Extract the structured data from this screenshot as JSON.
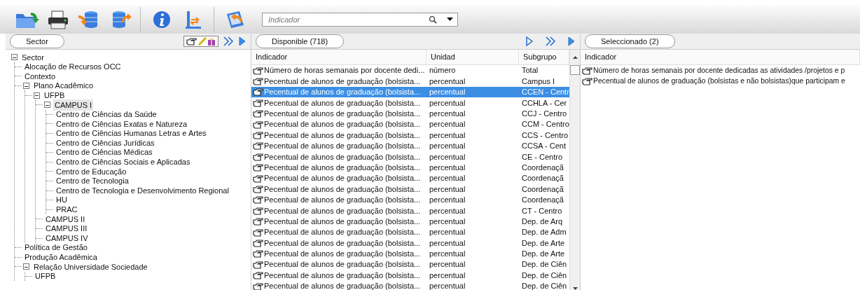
{
  "toolbar": {
    "search": {
      "placeholder": "Indicador"
    }
  },
  "sector_panel": {
    "title": "Sector",
    "tree": [
      {
        "label": "Sector",
        "expanded": true,
        "selected": false,
        "children": [
          {
            "label": "Alocação de Recursos OCC",
            "selected": false
          },
          {
            "label": "Contexto",
            "selected": false
          },
          {
            "label": "Plano Acadêmico",
            "expanded": true,
            "selected": false,
            "children": [
              {
                "label": "UFPB",
                "expanded": true,
                "selected": false,
                "children": [
                  {
                    "label": "CAMPUS I",
                    "expanded": true,
                    "selected": true,
                    "children": [
                      {
                        "label": "Centro de Ciências da Saúde",
                        "selected": false
                      },
                      {
                        "label": "Centro de Ciências Exatas e Natureza",
                        "selected": false
                      },
                      {
                        "label": "Centro de Ciências Humanas Letras e Artes",
                        "selected": false
                      },
                      {
                        "label": "Centro de Ciências Jurídicas",
                        "selected": false
                      },
                      {
                        "label": "Centro de Ciências Médicas",
                        "selected": false
                      },
                      {
                        "label": "Centro de Ciências Sociais e Aplicadas",
                        "selected": false
                      },
                      {
                        "label": "Centro de Educação",
                        "selected": false
                      },
                      {
                        "label": "Centro de Tecnologia",
                        "selected": false
                      },
                      {
                        "label": "Centro de Tecnologia e Desenvolvimento Regional",
                        "selected": false
                      },
                      {
                        "label": "HU",
                        "selected": false
                      },
                      {
                        "label": "PRAC",
                        "selected": false
                      }
                    ]
                  },
                  {
                    "label": "CAMPUS II",
                    "selected": false
                  },
                  {
                    "label": "CAMPUS III",
                    "selected": false
                  },
                  {
                    "label": "CAMPUS IV",
                    "selected": false
                  }
                ]
              }
            ]
          },
          {
            "label": "Política de Gestão",
            "selected": false
          },
          {
            "label": "Produção Acadêmica",
            "selected": false
          },
          {
            "label": "Relação Universidade Sociedade",
            "expanded": true,
            "selected": false,
            "children": [
              {
                "label": "UFPB",
                "selected": false
              }
            ]
          }
        ]
      }
    ]
  },
  "available_panel": {
    "title": "Disponible (718)",
    "table": {
      "columns": [
        "Indicador",
        "Unidad",
        "Subgrupo"
      ],
      "rows": [
        {
          "indicador": "Número de horas semanais por docente dedi...",
          "unidad": "número",
          "subgrupo": "Total",
          "selected": false
        },
        {
          "indicador": "Pecentual de alunos de graduação (bolsista...",
          "unidad": "percentual",
          "subgrupo": "Campus I",
          "selected": false
        },
        {
          "indicador": "Pecentual de alunos de graduação (bolsista...",
          "unidad": "percentual",
          "subgrupo": "CCEN - Centr",
          "selected": true
        },
        {
          "indicador": "Pecentual de alunos de graduação (bolsista...",
          "unidad": "percentual",
          "subgrupo": "CCHLA - Cer",
          "selected": false
        },
        {
          "indicador": "Pecentual de alunos de graduação (bolsista...",
          "unidad": "percentual",
          "subgrupo": "CCJ - Centro",
          "selected": false
        },
        {
          "indicador": "Pecentual de alunos de graduação (bolsista...",
          "unidad": "percentual",
          "subgrupo": "CCM - Centro",
          "selected": false
        },
        {
          "indicador": "Pecentual de alunos de graduação (bolsista...",
          "unidad": "percentual",
          "subgrupo": "CCS - Centro",
          "selected": false
        },
        {
          "indicador": "Pecentual de alunos de graduação (bolsista...",
          "unidad": "percentual",
          "subgrupo": "CCSA - Cent",
          "selected": false
        },
        {
          "indicador": "Pecentual de alunos de graduação (bolsista...",
          "unidad": "percentual",
          "subgrupo": "CE - Centro",
          "selected": false
        },
        {
          "indicador": "Pecentual de alunos de graduação (bolsista...",
          "unidad": "percentual",
          "subgrupo": "Coordenaçã",
          "selected": false
        },
        {
          "indicador": "Pecentual de alunos de graduação (bolsista...",
          "unidad": "percentual",
          "subgrupo": "Coordenaçã",
          "selected": false
        },
        {
          "indicador": "Pecentual de alunos de graduação (bolsista...",
          "unidad": "percentual",
          "subgrupo": "Coordenaçã",
          "selected": false
        },
        {
          "indicador": "Pecentual de alunos de graduação (bolsista...",
          "unidad": "percentual",
          "subgrupo": "Coordenaçã",
          "selected": false
        },
        {
          "indicador": "Pecentual de alunos de graduação (bolsista...",
          "unidad": "percentual",
          "subgrupo": "CT - Centro",
          "selected": false
        },
        {
          "indicador": "Pecentual de alunos de graduação (bolsista...",
          "unidad": "percentual",
          "subgrupo": "Dep. de  Arq",
          "selected": false
        },
        {
          "indicador": "Pecentual de alunos de graduação (bolsista...",
          "unidad": "percentual",
          "subgrupo": "Dep. de Adm",
          "selected": false
        },
        {
          "indicador": "Pecentual de alunos de graduação (bolsista...",
          "unidad": "percentual",
          "subgrupo": "Dep. de Arte",
          "selected": false
        },
        {
          "indicador": "Pecentual de alunos de graduação (bolsista...",
          "unidad": "percentual",
          "subgrupo": "Dep. de Arte",
          "selected": false
        },
        {
          "indicador": "Pecentual de alunos de graduação (bolsista...",
          "unidad": "percentual",
          "subgrupo": "Dep. de Ciên",
          "selected": false
        },
        {
          "indicador": "Pecentual de alunos de graduação (bolsista...",
          "unidad": "percentual",
          "subgrupo": "Dep. de Ciên",
          "selected": false
        },
        {
          "indicador": "Pecentual de alunos de graduação (bolsista...",
          "unidad": "percentual",
          "subgrupo": "Dep. de Ciên",
          "selected": false
        }
      ]
    }
  },
  "selected_panel": {
    "title": "Seleccionado (2)",
    "table": {
      "columns": [
        "Indicador"
      ],
      "rows": [
        {
          "indicador": "Número de horas semanais por docente dedicadas as atividades /projetos e p"
        },
        {
          "indicador": "Pecentual de alunos de graduação (bolsistas e não bolsistas)que participam e"
        }
      ]
    }
  }
}
